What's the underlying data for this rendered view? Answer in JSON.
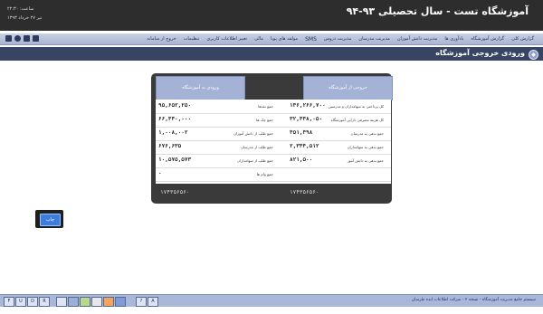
{
  "header": {
    "title": "آموزشگاه تست - سال تحصیلی ۹۳-۹۴",
    "time": "ساعت: ۲۲:۳۰",
    "date": "تیر ۲۷ خرداد ۱۳۹۳"
  },
  "menu": [
    "گزارش کلی",
    "گزارش آموزشگاه",
    "یادآوری ها",
    "مدیریت دانش آموزان",
    "مدیریت مدرسان",
    "مدیریت دروس",
    "SMS",
    "مولفه های پویا",
    "مالی",
    "تغییر اطلاعات کاربری",
    "تنظیمات",
    "خروج از سامانه"
  ],
  "toolbar_icons": [
    "user-icon",
    "print-icon",
    "chat-icon",
    "message-icon"
  ],
  "page_title": "ورودی خروجی آموزشگاه",
  "report": {
    "right_header": "خروجی از آموزشگاه",
    "left_header": "ورودی به آموزشگاه",
    "rows": [
      {
        "right_label": "کل پرداختی به سهامداران و مدرسین",
        "right_value": "۱۴۶,۲۶۶,۷۰۰",
        "left_label": "جمع نقدها",
        "left_value": "۹۵,۶۵۲,۲۵۰"
      },
      {
        "right_label": "کل هزینه مصرفی داراییِ آموزشگاه",
        "right_value": "۳۲,۴۴۸,۰۵۰",
        "left_label": "جمع چک ها",
        "left_value": "۶۶,۴۴۰,۰۰۰"
      },
      {
        "right_label": "جمع بدهی به مدرسان",
        "right_value": "۴۵۱,۴۹۸",
        "left_label": "جمع طلب از دانش آموزان",
        "left_value": "۱,۰۰۸,۰۰۲"
      },
      {
        "right_label": "جمع بدهی به سهامداران",
        "right_value": "۲,۳۴۴,۵۱۲",
        "left_label": "جمع طلب از مدرسان",
        "left_value": "۶۷۶,۶۳۵"
      },
      {
        "right_label": "جمع بدهی به دانش آموز",
        "right_value": "۸۲۱,۵۰۰",
        "left_label": "جمع طلب از سهامداران",
        "left_value": "۱۰,۵۷۵,۵۷۳"
      },
      {
        "right_label": "",
        "right_value": "",
        "left_label": "جمع وام ها",
        "left_value": "۰"
      }
    ],
    "right_total": "۱۷۴۳۵۶۵۶۰",
    "left_total": "۱۷۴۳۵۶۵۶۰"
  },
  "action_button": "چاپ",
  "status": {
    "text": "سیستم جامع مدیریت آموزشگاه - نسخه ۲ - شرکت اطلاعات ایده طرسان",
    "squares": [
      "F",
      "U",
      "D",
      "R"
    ],
    "squares2": [
      "?",
      "A"
    ],
    "theme_colors": [
      "#dfe6f3",
      "#9bb0d6",
      "#b6d98a",
      "#e8e8e8",
      "#f2a35e",
      "#7f9ad6"
    ]
  }
}
